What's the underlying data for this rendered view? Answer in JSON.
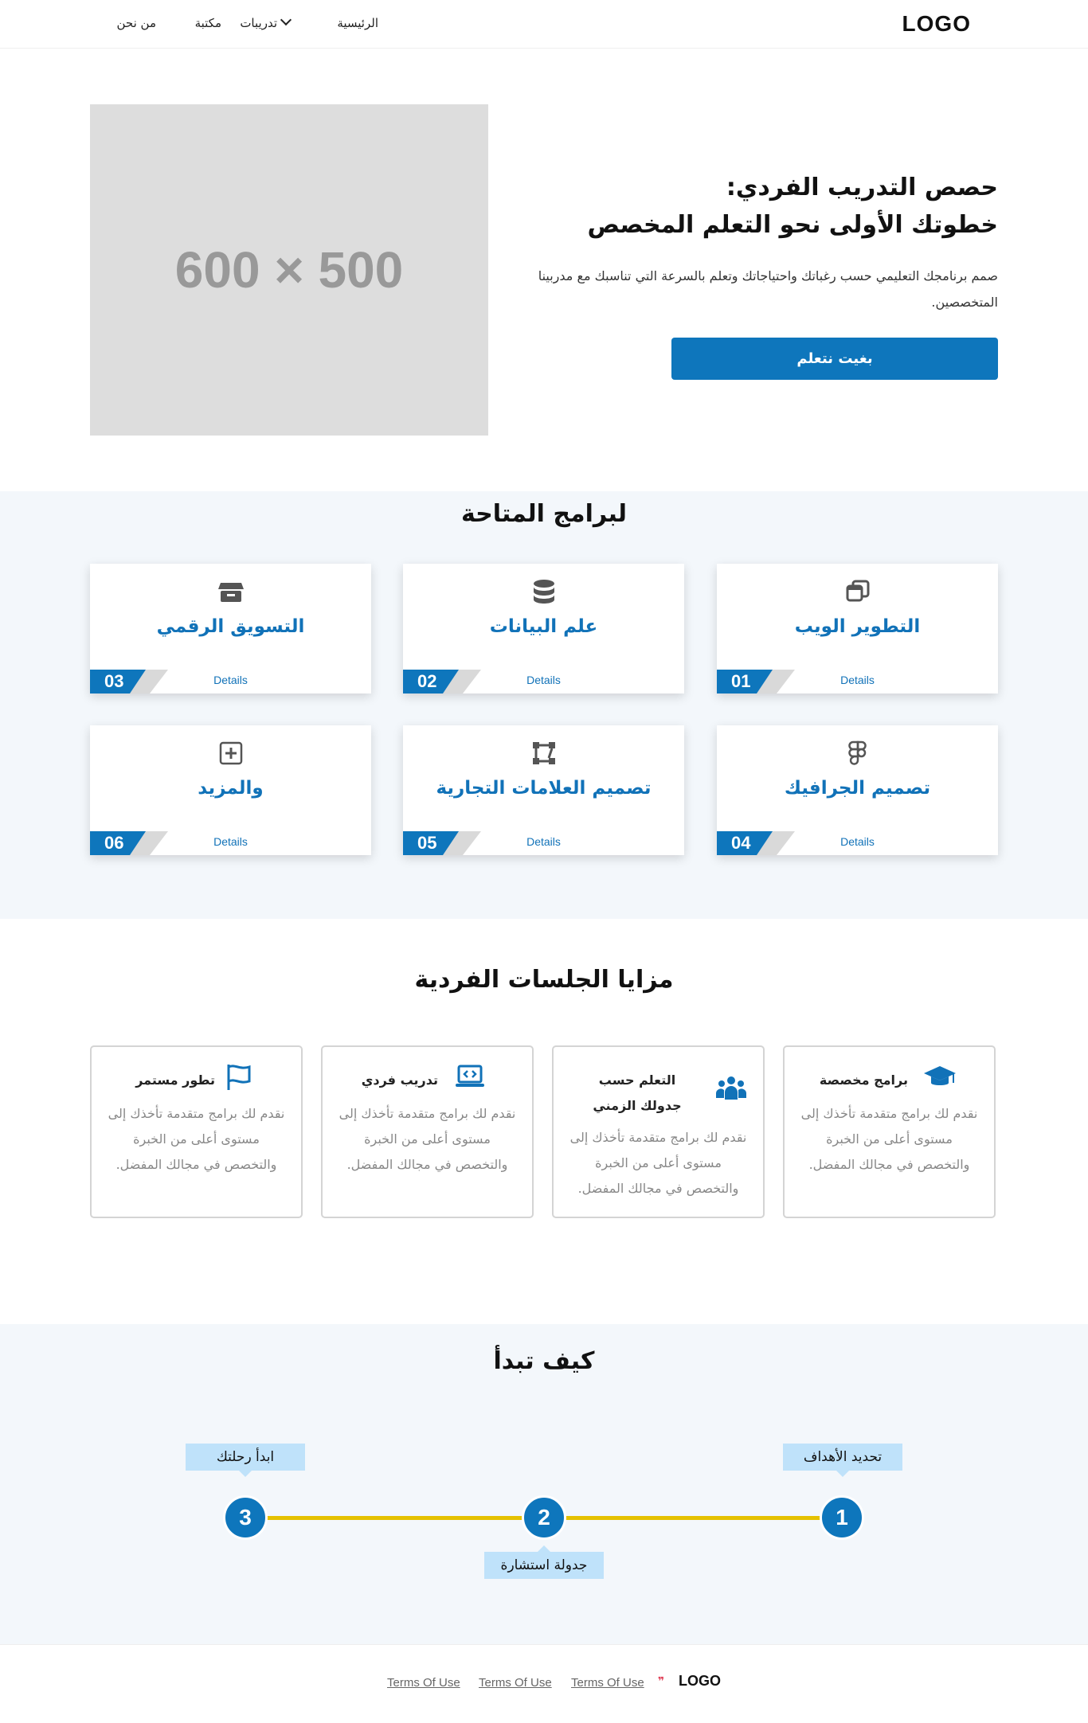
{
  "header": {
    "logo": "LOGO",
    "nav": {
      "home": "الرئيسية",
      "trainings": "تدريبات",
      "library": "مكتبة",
      "about": "من نحن"
    }
  },
  "hero": {
    "placeholder": "600 × 500",
    "title_line1": "حصص التدريب الفردي:",
    "title_line2": "خطوتك الأولى نحو التعلم المخصص",
    "description": "صمم برنامجك التعليمي حسب رغباتك واحتياجاتك وتعلم بالسرعة التي تناسبك مع مدربينا المتخصصين.",
    "cta": "بغيت نتعلم"
  },
  "programs": {
    "title": "لبرامج المتاحة",
    "details_label": "Details",
    "cards": [
      {
        "num": "01",
        "title": "التطوير الويب",
        "icon": "windows-icon"
      },
      {
        "num": "02",
        "title": "علم البيانات",
        "icon": "database-icon"
      },
      {
        "num": "03",
        "title": "التسويق الرقمي",
        "icon": "store-icon"
      },
      {
        "num": "04",
        "title": "تصميم الجرافيك",
        "icon": "figma-icon"
      },
      {
        "num": "05",
        "title": "تصميم العلامات التجارية",
        "icon": "vector-icon"
      },
      {
        "num": "06",
        "title": "والمزيد",
        "icon": "plus-square-icon"
      }
    ],
    "accent": "#0e76bc"
  },
  "benefits": {
    "title": "مزايا الجلسات الفردية",
    "items": [
      {
        "title": "برامج مخصصة",
        "icon": "graduation-cap-icon",
        "desc": "نقدم لك برامج متقدمة تأخذك إلى مستوى أعلى من الخبرة والتخصص في مجالك المفضل."
      },
      {
        "title": "التعلم حسب جدولك الزمني",
        "icon": "people-group-icon",
        "desc": "نقدم لك برامج متقدمة تأخذك إلى مستوى أعلى من الخبرة والتخصص في مجالك المفضل."
      },
      {
        "title": "تدريب فردي",
        "icon": "laptop-code-icon",
        "desc": "نقدم لك برامج متقدمة تأخذك إلى مستوى أعلى من الخبرة والتخصص في مجالك المفضل."
      },
      {
        "title": "تطور مستمر",
        "icon": "flag-icon",
        "desc": "نقدم لك برامج متقدمة تأخذك إلى مستوى أعلى من الخبرة والتخصص في مجالك المفضل."
      }
    ]
  },
  "steps": {
    "title": "كيف تبدأ",
    "items": [
      {
        "num": "1",
        "label": "تحديد الأهداف"
      },
      {
        "num": "2",
        "label": "جدولة استشارة"
      },
      {
        "num": "3",
        "label": "ابدأ رحلتك"
      }
    ],
    "line_color": "#e5c100"
  },
  "footer": {
    "logo": "LOGO",
    "links": [
      "Terms Of Use",
      "Terms Of Use",
      "Terms Of Use"
    ]
  }
}
